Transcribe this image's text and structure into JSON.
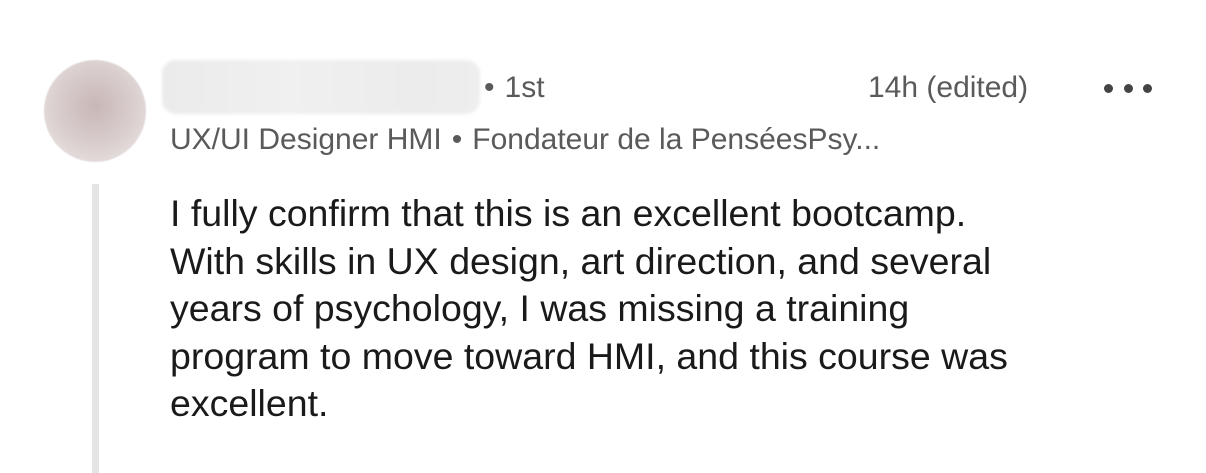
{
  "comment": {
    "connection_degree": "1st",
    "degree_separator": "•",
    "timestamp": "14h (edited)",
    "headline": {
      "role": "UX/UI Designer HMI",
      "separator": "•",
      "organization": "Fondateur de la PenséesPsy..."
    },
    "body_lines": [
      "I fully confirm that this is an excellent bootcamp.",
      "With skills in UX design, art direction, and several",
      "years of psychology, I was missing a training",
      "program to move toward HMI, and this course was",
      "excellent."
    ],
    "more_icon": "ellipsis-horizontal-icon"
  }
}
